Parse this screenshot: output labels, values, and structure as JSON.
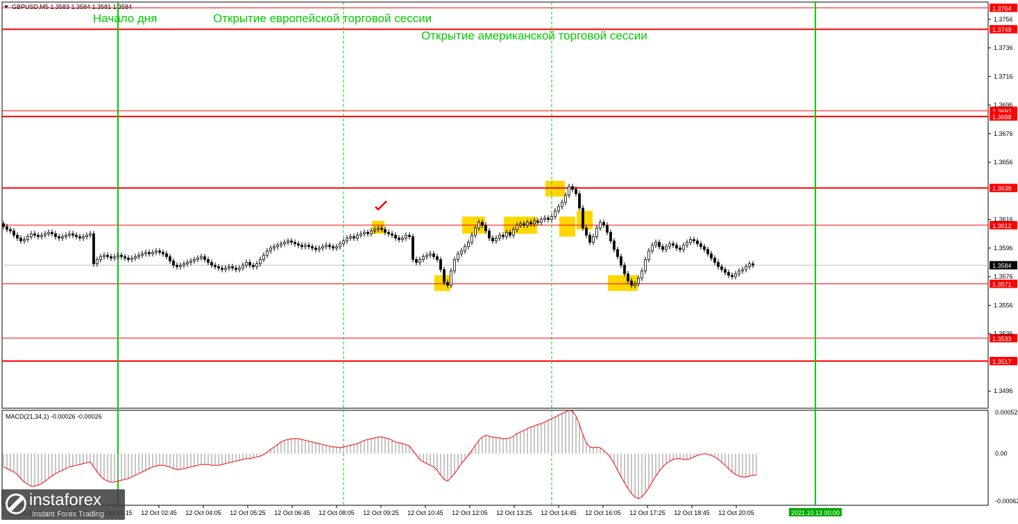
{
  "chart_data": {
    "type": "candlestick",
    "title": "GBPUSD,M5  1.3583 1.3584 1.3581 1.3584",
    "ylim": [
      1.3484,
      1.3768
    ],
    "y_ticks": [
      "1.3756",
      "1.3736",
      "1.3716",
      "1.3696",
      "1.3676",
      "1.3656",
      "1.3616",
      "1.3596",
      "1.3576",
      "1.3556",
      "1.3536",
      "1.3496"
    ],
    "x_ticks": [
      "11 Oct 22:25",
      "11 Oct 23:50",
      "12 Oct 01:15",
      "12 Oct 02:45",
      "12 Oct 04:05",
      "12 Oct 05:25",
      "12 Oct 06:45",
      "12 Oct 08:05",
      "12 Oct 09:25",
      "12 Oct 10:45",
      "12 Oct 12:05",
      "12 Oct 13:25",
      "12 Oct 14:45",
      "12 Oct 16:05",
      "12 Oct 17:25",
      "12 Oct 18:45",
      "12 Oct 20:05"
    ],
    "current_date_label": "2021.10.13 00:00",
    "levels": [
      {
        "value": 1.3764,
        "label": "1.3764",
        "thick": false
      },
      {
        "value": 1.3749,
        "label": "1.3749",
        "thick": true
      },
      {
        "value": 1.3692,
        "label": "1.3692",
        "thick": false
      },
      {
        "value": 1.3688,
        "label": "1.3688",
        "thick": true
      },
      {
        "value": 1.3638,
        "label": "1.3638",
        "thick": true
      },
      {
        "value": 1.3612,
        "label": "1.3612",
        "thick": false
      },
      {
        "value": 1.3571,
        "label": "1.3571",
        "thick": false
      },
      {
        "value": 1.3533,
        "label": "1.3533",
        "thick": false
      },
      {
        "value": 1.3517,
        "label": "1.3517",
        "thick": true
      }
    ],
    "current_price": {
      "value": 1.3584,
      "label": "1.3584"
    },
    "session_lines": [
      {
        "name": "Начало дня",
        "index": 33,
        "style": "solid"
      },
      {
        "name": "Открытие европейской торговой сессии",
        "index": 98,
        "style": "dashed"
      },
      {
        "name": "Открытие американской торговой сессии",
        "index": 158,
        "style": "dashed"
      },
      {
        "name": "",
        "index": 234,
        "style": "solid"
      }
    ],
    "highlights": [
      {
        "i0": 107,
        "i1": 109,
        "low": 1.3606,
        "high": 1.3615
      },
      {
        "i0": 125,
        "i1": 128,
        "low": 1.3566,
        "high": 1.3577
      },
      {
        "i0": 133,
        "i1": 138,
        "low": 1.3606,
        "high": 1.3618
      },
      {
        "i0": 145,
        "i1": 153,
        "low": 1.3606,
        "high": 1.3618
      },
      {
        "i0": 157,
        "i1": 161,
        "low": 1.3632,
        "high": 1.3643
      },
      {
        "i0": 161,
        "i1": 164,
        "low": 1.3604,
        "high": 1.3618
      },
      {
        "i0": 166,
        "i1": 169,
        "low": 1.3609,
        "high": 1.3622
      },
      {
        "i0": 175,
        "i1": 182,
        "low": 1.3566,
        "high": 1.3577
      }
    ],
    "checkmark_index": 108,
    "checkmark_value": 1.3623,
    "close": [
      1.3611,
      1.3609,
      1.3608,
      1.3605,
      1.3603,
      1.3601,
      1.3602,
      1.3604,
      1.3606,
      1.3605,
      1.3604,
      1.3605,
      1.3606,
      1.3607,
      1.3606,
      1.3604,
      1.3603,
      1.3604,
      1.3605,
      1.3606,
      1.3605,
      1.3604,
      1.3603,
      1.3604,
      1.3605,
      1.3606,
      1.3585,
      1.3588,
      1.359,
      1.3591,
      1.359,
      1.3589,
      1.359,
      1.3591,
      1.359,
      1.3589,
      1.3588,
      1.3589,
      1.359,
      1.3591,
      1.3592,
      1.3593,
      1.3592,
      1.3593,
      1.3594,
      1.3593,
      1.3592,
      1.359,
      1.3587,
      1.3584,
      1.3583,
      1.3584,
      1.3585,
      1.3586,
      1.3587,
      1.3588,
      1.3589,
      1.359,
      1.3588,
      1.3586,
      1.3584,
      1.3583,
      1.3582,
      1.3581,
      1.3582,
      1.3583,
      1.3582,
      1.3581,
      1.3582,
      1.3584,
      1.3586,
      1.3584,
      1.3583,
      1.3585,
      1.3588,
      1.3591,
      1.3594,
      1.3596,
      1.3597,
      1.3598,
      1.3599,
      1.36,
      1.3601,
      1.36,
      1.3599,
      1.3598,
      1.3597,
      1.3598,
      1.3597,
      1.3596,
      1.3595,
      1.3596,
      1.3597,
      1.3598,
      1.3597,
      1.3596,
      1.3597,
      1.3599,
      1.3601,
      1.3603,
      1.3604,
      1.3603,
      1.3605,
      1.3606,
      1.3607,
      1.3606,
      1.3608,
      1.3609,
      1.361,
      1.3609,
      1.3607,
      1.3606,
      1.3605,
      1.3603,
      1.3602,
      1.3603,
      1.3605,
      1.3604,
      1.3588,
      1.3586,
      1.3588,
      1.359,
      1.3591,
      1.3592,
      1.359,
      1.3588,
      1.3581,
      1.3572,
      1.357,
      1.358,
      1.3588,
      1.3592,
      1.3594,
      1.3597,
      1.36,
      1.3605,
      1.361,
      1.3614,
      1.3612,
      1.3608,
      1.3603,
      1.3601,
      1.3603,
      1.3605,
      1.3604,
      1.3607,
      1.3605,
      1.3609,
      1.3612,
      1.3613,
      1.3612,
      1.3614,
      1.3613,
      1.3615,
      1.3614,
      1.3616,
      1.3617,
      1.3616,
      1.3618,
      1.3622,
      1.3625,
      1.3628,
      1.3633,
      1.3639,
      1.3637,
      1.3634,
      1.3624,
      1.361,
      1.3605,
      1.36,
      1.3604,
      1.361,
      1.3614,
      1.3612,
      1.3607,
      1.3601,
      1.3595,
      1.359,
      1.3584,
      1.3578,
      1.3573,
      1.357,
      1.3571,
      1.3575,
      1.358,
      1.3588,
      1.3594,
      1.3598,
      1.36,
      1.3597,
      1.3595,
      1.3597,
      1.3599,
      1.3598,
      1.3596,
      1.3595,
      1.3598,
      1.36,
      1.3602,
      1.3601,
      1.3599,
      1.3597,
      1.3595,
      1.3592,
      1.3589,
      1.3586,
      1.3583,
      1.3581,
      1.3579,
      1.3577,
      1.3576,
      1.3578,
      1.358,
      1.3581,
      1.3583,
      1.3585,
      1.3584
    ],
    "macd": {
      "name": "MACD(21,34,1) -0.00026 -0.00026",
      "ylim": [
        -0.00062,
        0.00052
      ],
      "y_ticks": [
        "0.00052",
        "0.00",
        "-0.00062"
      ],
      "values": [
        -0.00016,
        -0.00018,
        -0.0002,
        -0.00022,
        -0.00025,
        -0.0003,
        -0.00034,
        -0.00037,
        -0.00039,
        -0.00039,
        -0.00038,
        -0.00036,
        -0.00033,
        -0.0003,
        -0.00027,
        -0.00024,
        -0.00022,
        -0.0002,
        -0.00018,
        -0.00016,
        -0.00015,
        -0.00014,
        -0.00013,
        -0.00012,
        -0.00011,
        -0.0001,
        -0.00016,
        -0.00022,
        -0.00027,
        -0.00031,
        -0.00033,
        -0.00034,
        -0.00034,
        -0.00033,
        -0.00032,
        -0.00031,
        -0.0003,
        -0.00028,
        -0.00026,
        -0.00024,
        -0.00022,
        -0.0002,
        -0.00018,
        -0.00016,
        -0.00015,
        -0.00014,
        -0.00014,
        -0.00015,
        -0.00016,
        -0.00018,
        -0.00019,
        -0.00019,
        -0.00018,
        -0.00017,
        -0.00016,
        -0.00015,
        -0.00014,
        -0.00013,
        -0.00013,
        -0.00013,
        -0.00014,
        -0.00014,
        -0.00014,
        -0.00013,
        -0.00012,
        -0.00011,
        -0.0001,
        -9e-05,
        -8e-05,
        -7e-05,
        -6e-05,
        -6e-05,
        -5e-05,
        -4e-05,
        -3e-05,
        -1e-05,
        2e-05,
        5e-05,
        8e-05,
        0.00011,
        0.00014,
        0.00016,
        0.00017,
        0.00018,
        0.00018,
        0.00018,
        0.00017,
        0.00016,
        0.00015,
        0.00014,
        0.00013,
        0.00012,
        0.00011,
        0.0001,
        9e-05,
        8e-05,
        8e-05,
        7e-05,
        8e-05,
        9e-05,
        0.0001,
        0.00011,
        0.00012,
        0.00014,
        0.00016,
        0.00017,
        0.00018,
        0.00019,
        0.0002,
        0.0002,
        0.00019,
        0.00018,
        0.00016,
        0.00014,
        0.00013,
        0.00012,
        0.00011,
        9e-05,
        4e-05,
        -2e-05,
        -7e-05,
        -0.0001,
        -0.00012,
        -0.00014,
        -0.00016,
        -0.0002,
        -0.00026,
        -0.00031,
        -0.00033,
        -0.00029,
        -0.00024,
        -0.00018,
        -0.00012,
        -7e-05,
        -2e-05,
        4e-05,
        0.0001,
        0.00016,
        0.0002,
        0.00022,
        0.00021,
        0.0002,
        0.00019,
        0.00019,
        0.00018,
        0.00018,
        0.00019,
        0.00021,
        0.00024,
        0.00026,
        0.00028,
        0.0003,
        0.00032,
        0.00033,
        0.00035,
        0.00036,
        0.00038,
        0.0004,
        0.00042,
        0.00044,
        0.00046,
        0.00048,
        0.0005,
        0.00052,
        0.00051,
        0.00045,
        0.00035,
        0.00023,
        0.00013,
        8e-05,
        7e-05,
        8e-05,
        7e-05,
        4e-05,
        0.0,
        -5e-05,
        -0.00012,
        -0.0002,
        -0.00028,
        -0.00035,
        -0.00042,
        -0.00048,
        -0.00052,
        -0.00054,
        -0.00052,
        -0.00047,
        -0.00041,
        -0.00034,
        -0.00027,
        -0.00021,
        -0.00016,
        -0.00012,
        -9e-05,
        -7e-05,
        -6e-05,
        -6e-05,
        -7e-05,
        -7e-05,
        -6e-05,
        -4e-05,
        -2e-05,
        -1e-05,
        0.0,
        -1e-05,
        -2e-05,
        -4e-05,
        -7e-05,
        -0.0001,
        -0.00014,
        -0.00018,
        -0.00022,
        -0.00025,
        -0.00027,
        -0.00028,
        -0.00028,
        -0.00027,
        -0.00026,
        -0.00026
      ]
    },
    "colors": {
      "level": "#ff0000",
      "session": "#00cc00",
      "highlight": "#ffd700",
      "candle": "#000000",
      "macd_line": "#ff0000",
      "macd_hist": "#a0a0a0",
      "current_price_line": "#c0c0c0",
      "date_badge": "#00aa00"
    }
  },
  "logo": {
    "name": "instaforex",
    "tagline": "Instant Forex Trading"
  }
}
